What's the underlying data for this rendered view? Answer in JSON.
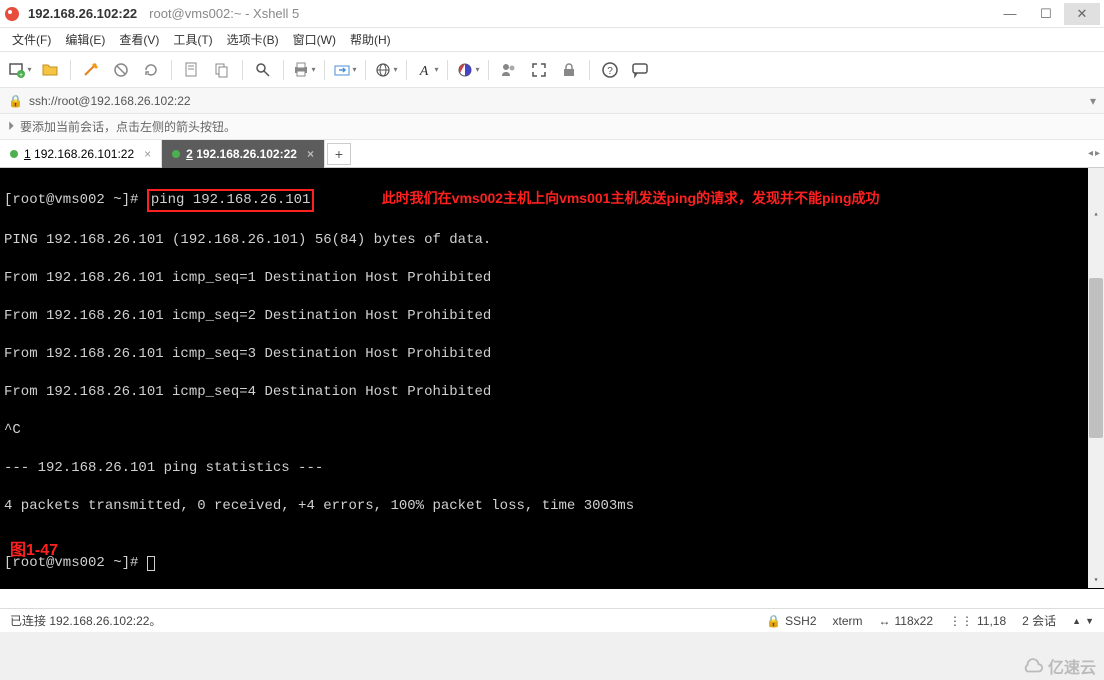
{
  "titlebar": {
    "main": "192.168.26.102:22",
    "sub": "root@vms002:~ - Xshell 5"
  },
  "menubar": {
    "items": [
      {
        "k": "F",
        "label": "文件(F)"
      },
      {
        "k": "E",
        "label": "编辑(E)"
      },
      {
        "k": "V",
        "label": "查看(V)"
      },
      {
        "k": "T",
        "label": "工具(T)"
      },
      {
        "k": "B",
        "label": "选项卡(B)"
      },
      {
        "k": "W",
        "label": "窗口(W)"
      },
      {
        "k": "H",
        "label": "帮助(H)"
      }
    ]
  },
  "addressbar": {
    "text": "ssh://root@192.168.26.102:22"
  },
  "infobar": {
    "text": "要添加当前会话，点击左侧的箭头按钮。"
  },
  "tabs": {
    "1": {
      "num": "1",
      "label": "192.168.26.101:22"
    },
    "2": {
      "num": "2",
      "label": "192.168.26.102:22"
    },
    "add": "+"
  },
  "terminal": {
    "prompt1": "[root@vms002 ~]# ",
    "cmd": "ping 192.168.26.101",
    "annotation": "此时我们在vms002主机上向vms001主机发送ping的请求，发现并不能ping成功",
    "l2": "PING 192.168.26.101 (192.168.26.101) 56(84) bytes of data.",
    "l3": "From 192.168.26.101 icmp_seq=1 Destination Host Prohibited",
    "l4": "From 192.168.26.101 icmp_seq=2 Destination Host Prohibited",
    "l5": "From 192.168.26.101 icmp_seq=3 Destination Host Prohibited",
    "l6": "From 192.168.26.101 icmp_seq=4 Destination Host Prohibited",
    "l7": "^C",
    "l8": "--- 192.168.26.101 ping statistics ---",
    "l9": "4 packets transmitted, 0 received, +4 errors, 100% packet loss, time 3003ms",
    "l10": "",
    "prompt2": "[root@vms002 ~]# ",
    "figure": "图1-47"
  },
  "statusbar": {
    "left": "已连接 192.168.26.102:22。",
    "ssh": "SSH2",
    "term": "xterm",
    "size": "118x22",
    "pos": "11,18",
    "sessions_label": "2 会话",
    "sessions_icons": "+  -"
  },
  "watermark": "亿速云"
}
